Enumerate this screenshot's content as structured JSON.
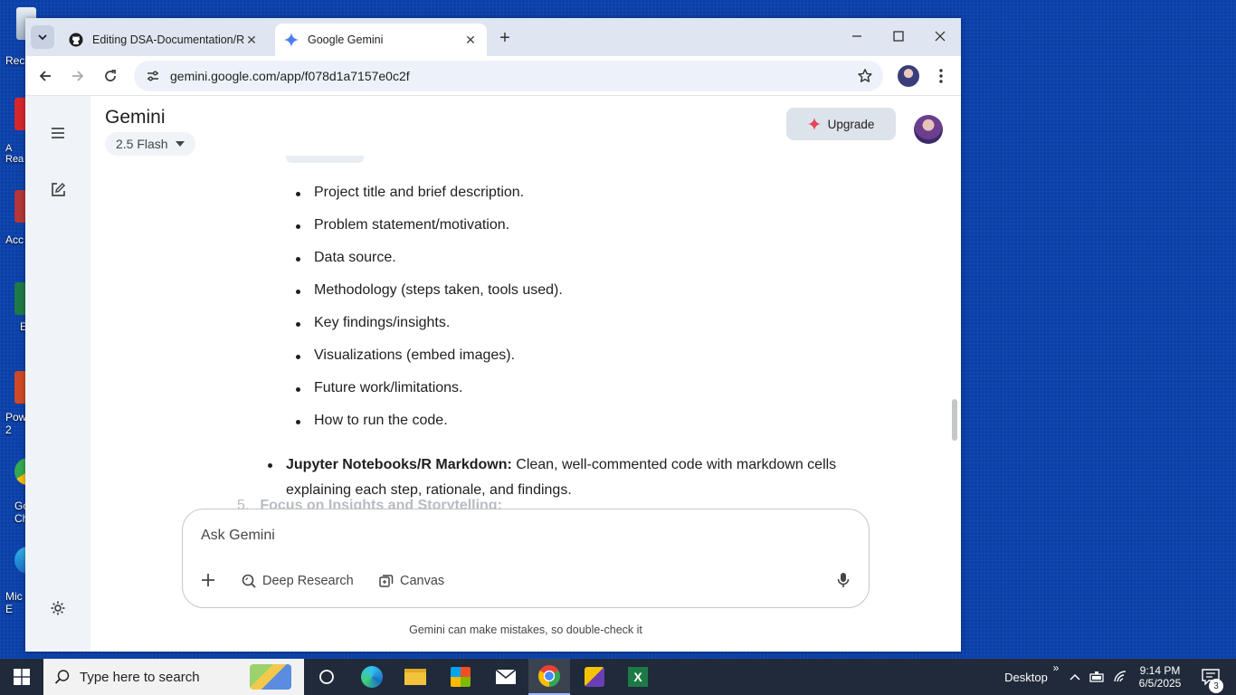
{
  "desktop": {
    "icon_labels": [
      "Rec",
      "A\nRea",
      "Acc",
      "E",
      "Pow\n2",
      "Go\nCh",
      "Mic\nE"
    ]
  },
  "browser": {
    "tabs": [
      {
        "title": "Editing DSA-Documentation/RE",
        "favicon": "github-icon",
        "active": false
      },
      {
        "title": "Google Gemini",
        "favicon": "gemini-icon",
        "active": true
      }
    ],
    "url": "gemini.google.com/app/f078d1a7157e0c2f"
  },
  "gemini": {
    "title": "Gemini",
    "model": "2.5 Flash",
    "upgrade_label": "Upgrade",
    "sub_items": [
      "Project title and brief description.",
      "Problem statement/motivation.",
      "Data source.",
      "Methodology (steps taken, tools used).",
      "Key findings/insights.",
      "Visualizations (embed images).",
      "Future work/limitations.",
      "How to run the code."
    ],
    "bullet_bold": "Jupyter Notebooks/R Markdown:",
    "bullet_text": " Clean, well-commented code with markdown cells explaining each step, rationale, and findings.",
    "faded_number": "5.",
    "faded_heading": "Focus on Insights and Storytelling:",
    "composer_placeholder": "Ask Gemini",
    "chips": [
      "Deep Research",
      "Canvas"
    ],
    "disclaimer": "Gemini can make mistakes, so double-check it"
  },
  "taskbar": {
    "search_placeholder": "Type here to search",
    "desktop_label": "Desktop",
    "time": "9:14 PM",
    "date": "6/5/2025",
    "notification_count": "3"
  }
}
